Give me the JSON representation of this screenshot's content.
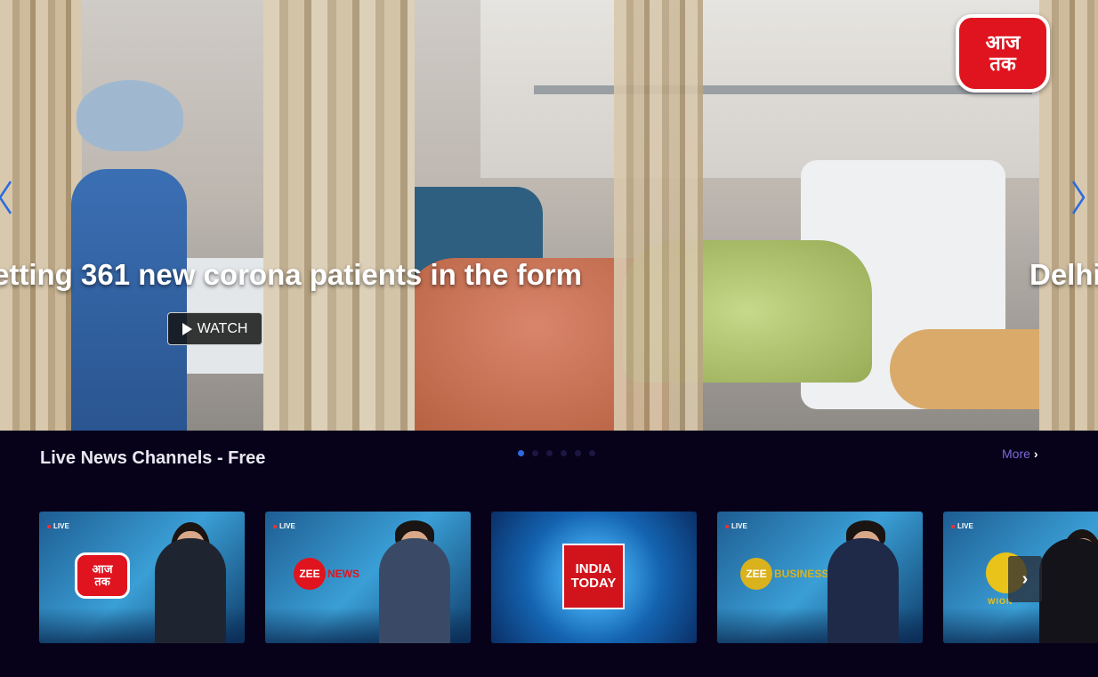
{
  "hero": {
    "headline": "etting 361 new corona patients in the form",
    "next_headline": "Delhi",
    "watch_label": "WATCH",
    "logo_text_top": "आज",
    "logo_text_bottom": "तक",
    "prev_icon": "chevron-left-icon",
    "next_icon": "chevron-right-icon"
  },
  "carousel": {
    "dot_count": 6,
    "active_index": 0,
    "active_color": "#2a6be0"
  },
  "section": {
    "title": "Live News Channels - Free",
    "more_label": "More",
    "more_color": "#7c6ad8"
  },
  "channels": [
    {
      "live_label": "LIVE",
      "brand_top": "आज",
      "brand_bottom": "तक"
    },
    {
      "live_label": "LIVE",
      "brand_circle": "ZEE",
      "brand_word": "NEWS"
    },
    {
      "brand_top": "INDIA",
      "brand_bottom": "TODAY"
    },
    {
      "live_label": "LIVE",
      "brand_circle": "ZEE",
      "brand_word": "BUSINESS"
    },
    {
      "live_label": "LIVE",
      "brand_word": "WION"
    }
  ],
  "colors": {
    "background": "#07021a",
    "brand_red": "#e0141e"
  }
}
